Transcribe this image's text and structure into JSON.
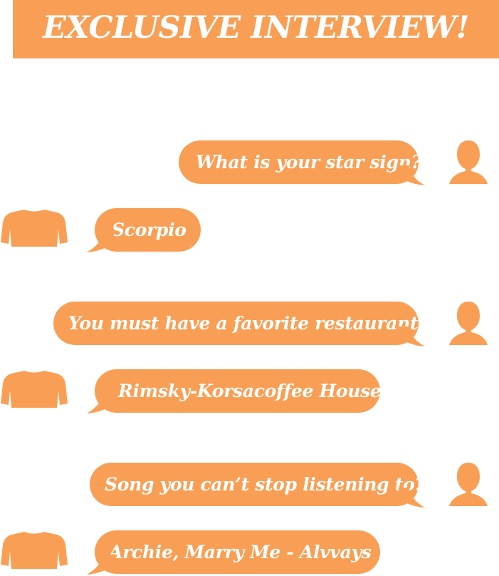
{
  "header": {
    "title": "EXCLUSIVE INTERVIEW!"
  },
  "conversation": [
    {
      "speaker": "interviewer",
      "text": "What is your star sign?"
    },
    {
      "speaker": "interviewee",
      "text": "Scorpio"
    },
    {
      "speaker": "interviewer",
      "text": "You must have a favorite restaurant?"
    },
    {
      "speaker": "interviewee",
      "text": "Rimsky-Korsacoffee House"
    },
    {
      "speaker": "interviewer",
      "text": "Song you can’t stop listening to?"
    },
    {
      "speaker": "interviewee",
      "text": "Archie, Marry Me - Alvvays"
    }
  ],
  "icons": {
    "interviewer": "person-silhouette-icon",
    "interviewee": "sweater-icon"
  },
  "colors": {
    "accent": "#f99f55",
    "text": "#ffffff",
    "background": "#ffffff"
  }
}
